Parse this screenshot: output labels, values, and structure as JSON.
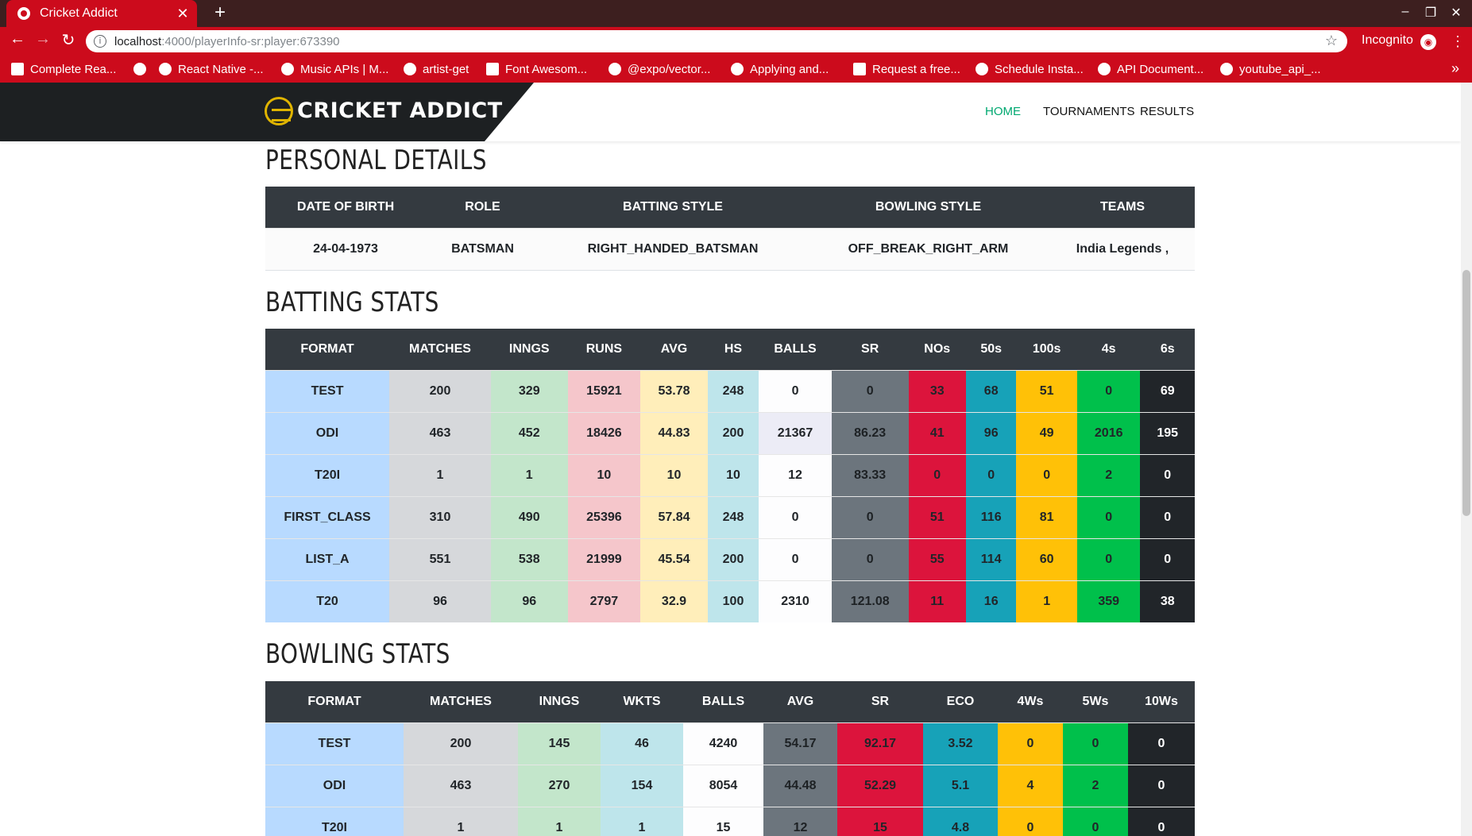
{
  "browser": {
    "tab_title": "Cricket Addict",
    "url_host": "localhost",
    "url_path": ":4000/playerInfo-sr:player:673390",
    "incognito_label": "Incognito",
    "bookmarks": [
      {
        "label": "Complete Rea..."
      },
      {
        "label": ""
      },
      {
        "label": "React Native -..."
      },
      {
        "label": "Music APIs | M..."
      },
      {
        "label": "artist-get"
      },
      {
        "label": "Font Awesom..."
      },
      {
        "label": "@expo/vector..."
      },
      {
        "label": "Applying and..."
      },
      {
        "label": "Request a free..."
      },
      {
        "label": "Schedule Insta..."
      },
      {
        "label": "API Document..."
      },
      {
        "label": "youtube_api_..."
      }
    ]
  },
  "site": {
    "brand": "CRICKET ADDICT",
    "nav": {
      "home": "HOME",
      "tournaments": "TOURNAMENTS",
      "results": "RESULTS"
    },
    "accent_color": "#00a870"
  },
  "personal": {
    "title": "PERSONAL DETAILS",
    "headers": [
      "DATE OF BIRTH",
      "ROLE",
      "BATTING STYLE",
      "BOWLING STYLE",
      "TEAMS"
    ],
    "values": [
      "24-04-1973",
      "BATSMAN",
      "RIGHT_HANDED_BATSMAN",
      "OFF_BREAK_RIGHT_ARM",
      "India Legends ,"
    ]
  },
  "batting": {
    "title": "BATTING STATS",
    "headers": [
      "FORMAT",
      "MATCHES",
      "INNGS",
      "RUNS",
      "AVG",
      "HS",
      "BALLS",
      "SR",
      "NOs",
      "50s",
      "100s",
      "4s",
      "6s"
    ],
    "rows": [
      [
        "TEST",
        "200",
        "329",
        "15921",
        "53.78",
        "248",
        "0",
        "0",
        "33",
        "68",
        "51",
        "0",
        "69"
      ],
      [
        "ODI",
        "463",
        "452",
        "18426",
        "44.83",
        "200",
        "21367",
        "86.23",
        "41",
        "96",
        "49",
        "2016",
        "195"
      ],
      [
        "T20I",
        "1",
        "1",
        "10",
        "10",
        "10",
        "12",
        "83.33",
        "0",
        "0",
        "0",
        "2",
        "0"
      ],
      [
        "FIRST_CLASS",
        "310",
        "490",
        "25396",
        "57.84",
        "248",
        "0",
        "0",
        "51",
        "116",
        "81",
        "0",
        "0"
      ],
      [
        "LIST_A",
        "551",
        "538",
        "21999",
        "45.54",
        "200",
        "0",
        "0",
        "55",
        "114",
        "60",
        "0",
        "0"
      ],
      [
        "T20",
        "96",
        "96",
        "2797",
        "32.9",
        "100",
        "2310",
        "121.08",
        "11",
        "16",
        "1",
        "359",
        "38"
      ]
    ]
  },
  "bowling": {
    "title": "BOWLING STATS",
    "headers": [
      "FORMAT",
      "MATCHES",
      "INNGS",
      "WKTS",
      "BALLS",
      "AVG",
      "SR",
      "ECO",
      "4Ws",
      "5Ws",
      "10Ws"
    ],
    "rows": [
      [
        "TEST",
        "200",
        "145",
        "46",
        "4240",
        "54.17",
        "92.17",
        "3.52",
        "0",
        "0",
        "0"
      ],
      [
        "ODI",
        "463",
        "270",
        "154",
        "8054",
        "44.48",
        "52.29",
        "5.1",
        "4",
        "2",
        "0"
      ],
      [
        "T20I",
        "1",
        "1",
        "1",
        "15",
        "12",
        "15",
        "4.8",
        "0",
        "0",
        "0"
      ]
    ]
  }
}
